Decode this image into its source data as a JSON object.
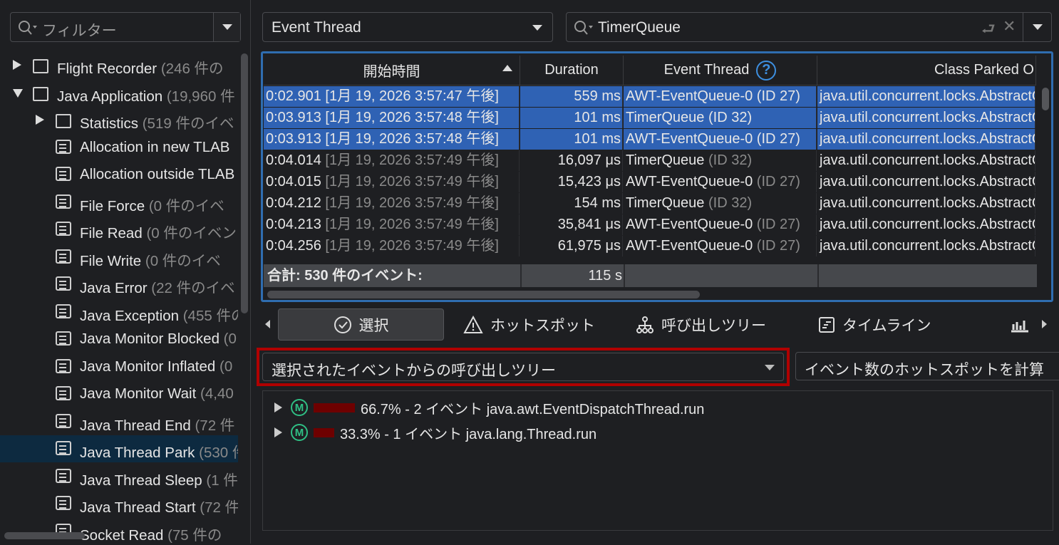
{
  "sidebar": {
    "filter_placeholder": "フィルター",
    "items": [
      {
        "name": "Flight Recorder",
        "count": " (246 件の",
        "level": 0,
        "type": "folder",
        "state": "collapsed"
      },
      {
        "name": "Java Application",
        "count": " (19,960 件",
        "level": 0,
        "type": "folder",
        "state": "expanded"
      },
      {
        "name": "Statistics",
        "count": " (519 件のイベ",
        "level": 1,
        "type": "folder",
        "state": "collapsed"
      },
      {
        "name": "Allocation in new TLAB",
        "count": "",
        "level": 1,
        "type": "doc"
      },
      {
        "name": "Allocation outside TLAB",
        "count": "",
        "level": 1,
        "type": "doc"
      },
      {
        "name": "File Force",
        "count": " (0 件のイベ",
        "level": 1,
        "type": "doc"
      },
      {
        "name": "File Read",
        "count": " (0 件のイベン",
        "level": 1,
        "type": "doc"
      },
      {
        "name": "File Write",
        "count": " (0 件のイベ",
        "level": 1,
        "type": "doc"
      },
      {
        "name": "Java Error",
        "count": " (22 件のイベ",
        "level": 1,
        "type": "doc"
      },
      {
        "name": "Java Exception",
        "count": " (455 件の",
        "level": 1,
        "type": "doc"
      },
      {
        "name": "Java Monitor Blocked",
        "count": " (0",
        "level": 1,
        "type": "doc"
      },
      {
        "name": "Java Monitor Inflated",
        "count": " (0",
        "level": 1,
        "type": "doc"
      },
      {
        "name": "Java Monitor Wait",
        "count": " (4,40",
        "level": 1,
        "type": "doc"
      },
      {
        "name": "Java Thread End",
        "count": " (72 件",
        "level": 1,
        "type": "doc"
      },
      {
        "name": "Java Thread Park",
        "count": " (530 件",
        "level": 1,
        "type": "doc",
        "selected": true
      },
      {
        "name": "Java Thread Sleep",
        "count": " (1 件",
        "level": 1,
        "type": "doc"
      },
      {
        "name": "Java Thread Start",
        "count": " (72 件",
        "level": 1,
        "type": "doc"
      },
      {
        "name": "Socket Read",
        "count": " (75 件の",
        "level": 1,
        "type": "doc"
      }
    ]
  },
  "toolbar": {
    "thread_combo": "Event Thread",
    "search_value": "TimerQueue"
  },
  "table": {
    "columns": [
      "開始時間",
      "Duration",
      "Event Thread",
      "Class Parked O"
    ],
    "rows": [
      {
        "time": "0:02.901",
        "date": " [1月 19, 2026 3:57:47 午後]",
        "duration": "559 ms",
        "thread": "AWT-EventQueue-0",
        "tid": " (ID 27)",
        "cls": "java.util.concurrent.locks.AbstractQueuedSynchronizer",
        "selected": true
      },
      {
        "time": "0:03.913",
        "date": " [1月 19, 2026 3:57:48 午後]",
        "duration": "101 ms",
        "thread": "TimerQueue",
        "tid": " (ID 32)",
        "cls": "java.util.concurrent.locks.AbstractQueuedSynchronizer",
        "selected": true
      },
      {
        "time": "0:03.913",
        "date": " [1月 19, 2026 3:57:48 午後]",
        "duration": "101 ms",
        "thread": "AWT-EventQueue-0",
        "tid": " (ID 27)",
        "cls": "java.util.concurrent.locks.AbstractQueuedSynchronizer",
        "selected": true
      },
      {
        "time": "0:04.014",
        "date": " [1月 19, 2026 3:57:49 午後]",
        "duration": "16,097 μs",
        "thread": "TimerQueue",
        "tid": " (ID 32)",
        "cls": "java.util.concurrent.locks.AbstractQueuedSynchronizer"
      },
      {
        "time": "0:04.015",
        "date": " [1月 19, 2026 3:57:49 午後]",
        "duration": "15,423 μs",
        "thread": "AWT-EventQueue-0",
        "tid": " (ID 27)",
        "cls": "java.util.concurrent.locks.AbstractQueuedSynchronizer"
      },
      {
        "time": "0:04.212",
        "date": " [1月 19, 2026 3:57:49 午後]",
        "duration": "154 ms",
        "thread": "TimerQueue",
        "tid": " (ID 32)",
        "cls": "java.util.concurrent.locks.AbstractQueuedSynchronizer"
      },
      {
        "time": "0:04.213",
        "date": " [1月 19, 2026 3:57:49 午後]",
        "duration": "35,841 μs",
        "thread": "AWT-EventQueue-0",
        "tid": " (ID 27)",
        "cls": "java.util.concurrent.locks.AbstractQueuedSynchronizer"
      },
      {
        "time": "0:04.256",
        "date": " [1月 19, 2026 3:57:49 午後]",
        "duration": "61,975 μs",
        "thread": "AWT-EventQueue-0",
        "tid": " (ID 27)",
        "cls": "java.util.concurrent.locks.AbstractQueuedSynchronizer"
      }
    ],
    "total_label": "合計: 530 件のイベント:",
    "total_duration": "115 s"
  },
  "tabs": [
    "選択",
    "ホットスポット",
    "呼び出しツリー",
    "タイムライン"
  ],
  "calltree": {
    "mode": "選択されたイベントからの呼び出しツリー",
    "hotspot_button": "イベント数のホットスポットを計算",
    "nodes": [
      {
        "percent": 66.7,
        "text": "66.7% - 2 イベント java.awt.EventDispatchThread.run"
      },
      {
        "percent": 33.3,
        "text": "33.3% - 1 イベント java.lang.Thread.run"
      }
    ]
  },
  "colors": {
    "selection": "#2f62b4",
    "highlight_box": "#b00000",
    "method_icon": "#2fbf84"
  }
}
